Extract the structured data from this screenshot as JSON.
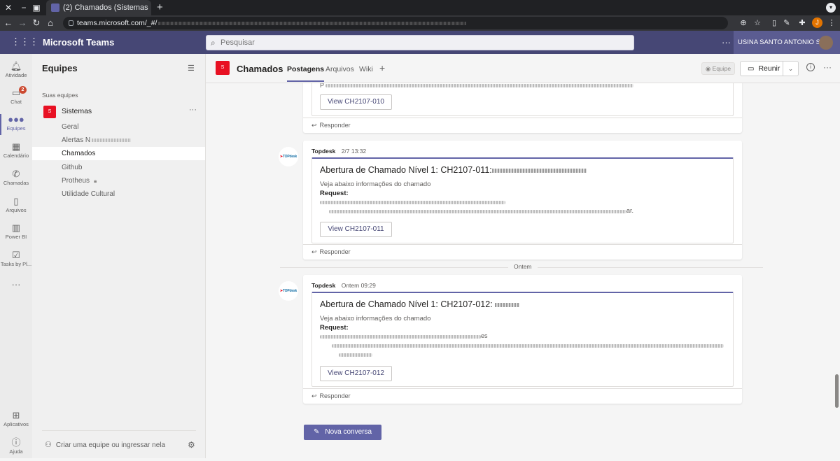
{
  "browser": {
    "tab_title": "(2) Chamados (Sistemas",
    "new_tab": "+",
    "url": "teams.microsoft.com/_#/",
    "profile_initial": "J"
  },
  "header": {
    "app_name": "Microsoft Teams",
    "search_placeholder": "Pesquisar",
    "more": "···",
    "org_name": "USINA SANTO ANTONIO S/A"
  },
  "appbar": {
    "items": [
      {
        "label": "Atividade",
        "icon": "bell-icon"
      },
      {
        "label": "Chat",
        "icon": "chat-icon",
        "badge": "2"
      },
      {
        "label": "Equipes",
        "icon": "teams-icon"
      },
      {
        "label": "Calendário",
        "icon": "calendar-icon"
      },
      {
        "label": "Chamadas",
        "icon": "phone-icon"
      },
      {
        "label": "Arquivos",
        "icon": "file-icon"
      },
      {
        "label": "Power BI",
        "icon": "powerbi-icon"
      },
      {
        "label": "Tasks by Pl...",
        "icon": "tasks-icon"
      },
      {
        "label": "Aplicativos",
        "icon": "apps-icon"
      },
      {
        "label": "Ajuda",
        "icon": "help-icon"
      }
    ],
    "more": "···"
  },
  "left_panel": {
    "title": "Equipes",
    "section_label": "Suas equipes",
    "team": {
      "avatar": "S",
      "name": "Sistemas",
      "more": "···"
    },
    "channels": [
      {
        "name": "Geral"
      },
      {
        "name": "Alertas N"
      },
      {
        "name": "Chamados"
      },
      {
        "name": "Github"
      },
      {
        "name": "Protheus"
      },
      {
        "name": "Utilidade Cultural"
      }
    ],
    "create_team": "Criar uma equipe ou ingressar nela"
  },
  "channel_header": {
    "avatar": "S",
    "title": "Chamados",
    "tabs": [
      "Postagens",
      "Arquivos",
      "Wiki"
    ],
    "add_tab": "+",
    "team_button": "Equipe",
    "meet_button": "Reunir",
    "more": "···"
  },
  "feed": {
    "posts": [
      {
        "author": "",
        "time": "",
        "body_start": "P",
        "button": "View CH2107-010",
        "reply": "Responder"
      },
      {
        "author": "Topdesk",
        "time": "2/7 13:32",
        "title": "Abertura de Chamado Nível 1: CH2107-011:",
        "subtitle": "Veja abaixo informações do chamado",
        "request_label": "Request:",
        "body_end": "ar.",
        "button": "View CH2107-011",
        "reply": "Responder"
      },
      {
        "author": "Topdesk",
        "time": "Ontem 09:29",
        "title": "Abertura de Chamado Nível 1: CH2107-012:",
        "subtitle": "Veja abaixo informações do chamado",
        "request_label": "Request:",
        "body_end": "es",
        "button": "View CH2107-012",
        "reply": "Responder"
      }
    ],
    "day_separator": "Ontem",
    "bot_logo": "TOPdesk",
    "new_conversation": "Nova conversa"
  },
  "colors": {
    "accent": "#6264a7",
    "header_bg": "#464775",
    "team_avatar": "#e81123"
  }
}
